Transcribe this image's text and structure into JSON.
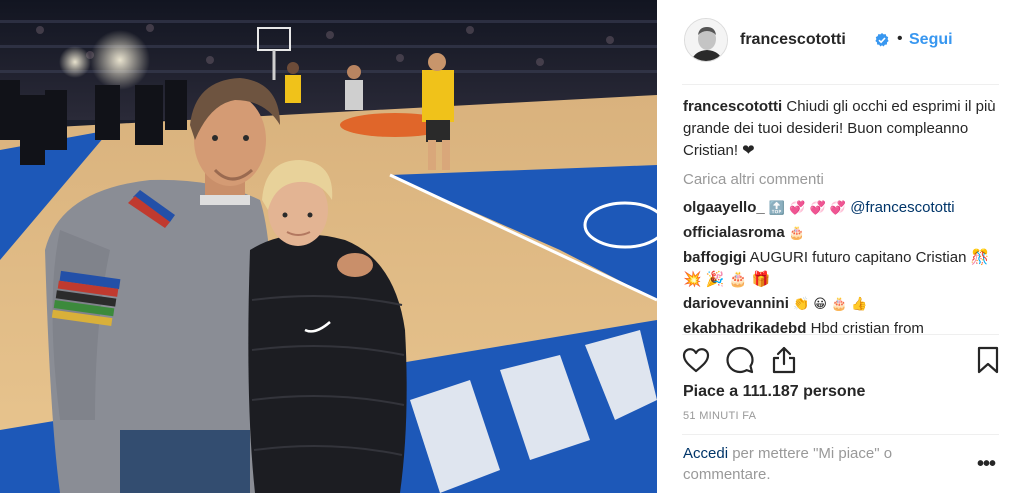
{
  "post": {
    "image_alt": "Father and son on a basketball court"
  },
  "header": {
    "username": "francescototti",
    "separator": "•",
    "follow_label": "Segui"
  },
  "caption": {
    "username": "francescototti",
    "text": "Chiudi gli occhi ed esprimi il più grande dei tuoi desideri! Buon compleanno Cristian! ❤"
  },
  "load_more_label": "Carica altri commenti",
  "comments": [
    {
      "username": "olgaayello_",
      "text": "🔝 💞 💞 💞",
      "mention": "@francescototti"
    },
    {
      "username": "officialasroma",
      "text": "🎂",
      "mention": ""
    },
    {
      "username": "baffogigi",
      "text": "AUGURI futuro capitano Cristian 🎊 💥 🎉 🎂 🎁",
      "mention": ""
    },
    {
      "username": "dariovevannini",
      "text": "👏 😀 🎂 👍",
      "mention": ""
    },
    {
      "username": "ekabhadrikadebd",
      "text": "Hbd cristian from",
      "mention": ""
    }
  ],
  "likes_label": "Piace a 111.187 persone",
  "time_label": "51 MINUTI FA",
  "login": {
    "link_label": "Accedi",
    "text": " per mettere \"Mi piace\" o commentare."
  },
  "more_label": "•••",
  "colors": {
    "link_blue": "#3897f0",
    "mention_blue": "#003569",
    "muted_gray": "#999999",
    "verified_blue": "#3897f0"
  },
  "icons": [
    "heart-icon",
    "comment-icon",
    "share-icon",
    "bookmark-icon",
    "verified-badge-icon",
    "more-options-icon"
  ]
}
